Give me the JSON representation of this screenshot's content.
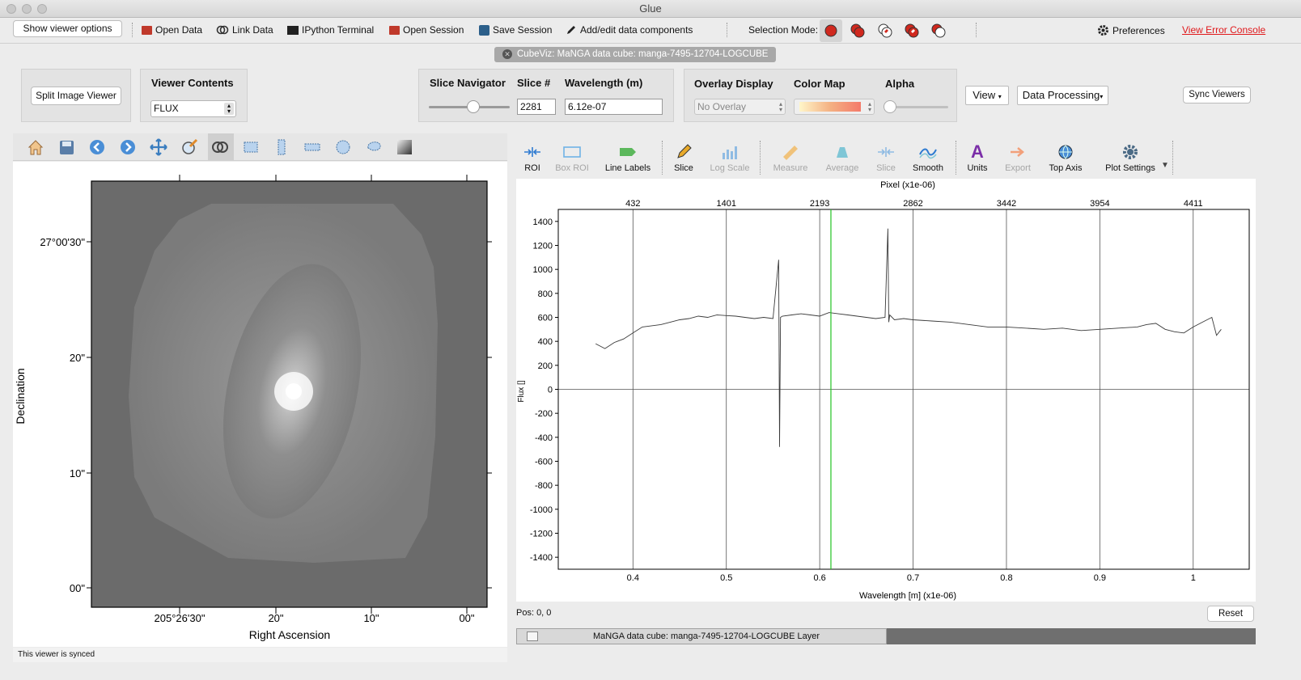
{
  "window": {
    "title": "Glue"
  },
  "toolbar": {
    "show_viewer_options": "Show viewer options",
    "open_data": "Open Data",
    "link_data": "Link Data",
    "ipython_terminal": "IPython Terminal",
    "open_session": "Open Session",
    "save_session": "Save Session",
    "add_edit_components": "Add/edit data components",
    "selection_mode": "Selection Mode:",
    "preferences": "Preferences",
    "view_error_console": "View Error Console",
    "error_link_color": "#e0191c"
  },
  "tab": {
    "label": "CubeViz: MaNGA data cube: manga-7495-12704-LOGCUBE"
  },
  "controls": {
    "split_image_viewer": "Split Image Viewer",
    "viewer_contents_label": "Viewer Contents",
    "viewer_contents_value": "FLUX",
    "slice_navigator_label": "Slice Navigator",
    "slice_number_label": "Slice #",
    "wavelength_label": "Wavelength (m)",
    "slice_number_value": "2281",
    "wavelength_value": "6.12e-07",
    "slice_position": 0.55,
    "overlay_display_label": "Overlay Display",
    "overlay_value": "No Overlay",
    "color_map_label": "Color Map",
    "alpha_label": "Alpha",
    "alpha_value": 0.0,
    "view_button": "View",
    "data_processing_button": "Data Processing",
    "sync_viewers_button": "Sync Viewers"
  },
  "image_viewer": {
    "ylabel": "Declination",
    "xlabel": "Right Ascension",
    "dec_ticks": [
      "27°00'30\"",
      "20\"",
      "10\"",
      "00\""
    ],
    "ra_ticks": [
      "205°26'30\"",
      "20\"",
      "10\"",
      "00\""
    ],
    "status": "This viewer is synced",
    "toolbar_icons": [
      "home-icon",
      "save-icon",
      "back-icon",
      "forward-icon",
      "pan-icon",
      "zoom-edit-icon",
      "link-circles-icon",
      "rectangle-roi-icon",
      "vertical-roi-icon",
      "horizontal-roi-icon",
      "circle-roi-icon",
      "lasso-roi-icon",
      "contrast-icon"
    ]
  },
  "spectrum_viewer": {
    "tools": [
      {
        "label": "ROI",
        "enabled": true
      },
      {
        "label": "Box ROI",
        "enabled": false
      },
      {
        "label": "Line Labels",
        "enabled": true
      },
      {
        "label": "Slice",
        "enabled": true
      },
      {
        "label": "Log Scale",
        "enabled": false
      },
      {
        "label": "Measure",
        "enabled": false
      },
      {
        "label": "Average",
        "enabled": false
      },
      {
        "label": "Slice",
        "enabled": false
      },
      {
        "label": "Smooth",
        "enabled": true
      },
      {
        "label": "Units",
        "enabled": true
      },
      {
        "label": "Export",
        "enabled": false
      },
      {
        "label": "Top Axis",
        "enabled": true
      },
      {
        "label": "Plot Settings",
        "enabled": true
      }
    ],
    "position_readout": "Pos: 0, 0",
    "reset_button": "Reset",
    "layer_label": "MaNGA data cube: manga-7495-12704-LOGCUBE Layer"
  },
  "chart_data": {
    "type": "line",
    "xlabel": "Wavelength [m] (x1e-06)",
    "ylabel": "Flux []",
    "top_axis_label": "Pixel (x1e-06)",
    "xlim": [
      0.32,
      1.06
    ],
    "ylim": [
      -1500,
      1500
    ],
    "x_ticks": [
      0.4,
      0.5,
      0.6,
      0.7,
      0.8,
      0.9,
      1
    ],
    "y_ticks": [
      1400,
      1200,
      1000,
      800,
      600,
      400,
      200,
      0,
      -200,
      -400,
      -600,
      -800,
      -1000,
      -1200,
      -1400
    ],
    "top_ticks": [
      {
        "label": "432",
        "x": 0.4
      },
      {
        "label": "1401",
        "x": 0.5
      },
      {
        "label": "2193",
        "x": 0.6
      },
      {
        "label": "2862",
        "x": 0.7
      },
      {
        "label": "3442",
        "x": 0.8
      },
      {
        "label": "3954",
        "x": 0.9
      },
      {
        "label": "4411",
        "x": 1.0
      }
    ],
    "slice_marker_x": 0.612,
    "grid": true,
    "series": [
      {
        "x": [
          0.36,
          0.37,
          0.38,
          0.39,
          0.4,
          0.41,
          0.42,
          0.43,
          0.44,
          0.45,
          0.46,
          0.47,
          0.48,
          0.49,
          0.5,
          0.51,
          0.52,
          0.53,
          0.54,
          0.55,
          0.556,
          0.557,
          0.558,
          0.56,
          0.57,
          0.58,
          0.59,
          0.6,
          0.61,
          0.62,
          0.63,
          0.64,
          0.65,
          0.66,
          0.67,
          0.673,
          0.674,
          0.675,
          0.68,
          0.69,
          0.7,
          0.72,
          0.74,
          0.76,
          0.78,
          0.8,
          0.82,
          0.84,
          0.86,
          0.88,
          0.9,
          0.92,
          0.94,
          0.95,
          0.96,
          0.97,
          0.98,
          0.99,
          1.0,
          1.01,
          1.02,
          1.025,
          1.03
        ],
        "y": [
          380,
          340,
          390,
          420,
          470,
          520,
          530,
          540,
          560,
          580,
          590,
          610,
          600,
          620,
          615,
          610,
          600,
          590,
          600,
          590,
          1080,
          -480,
          600,
          610,
          620,
          630,
          620,
          610,
          640,
          630,
          620,
          610,
          600,
          590,
          600,
          1340,
          560,
          620,
          580,
          590,
          580,
          570,
          560,
          540,
          520,
          520,
          510,
          500,
          510,
          490,
          500,
          510,
          520,
          540,
          550,
          500,
          480,
          470,
          520,
          560,
          600,
          450,
          500
        ]
      }
    ]
  }
}
